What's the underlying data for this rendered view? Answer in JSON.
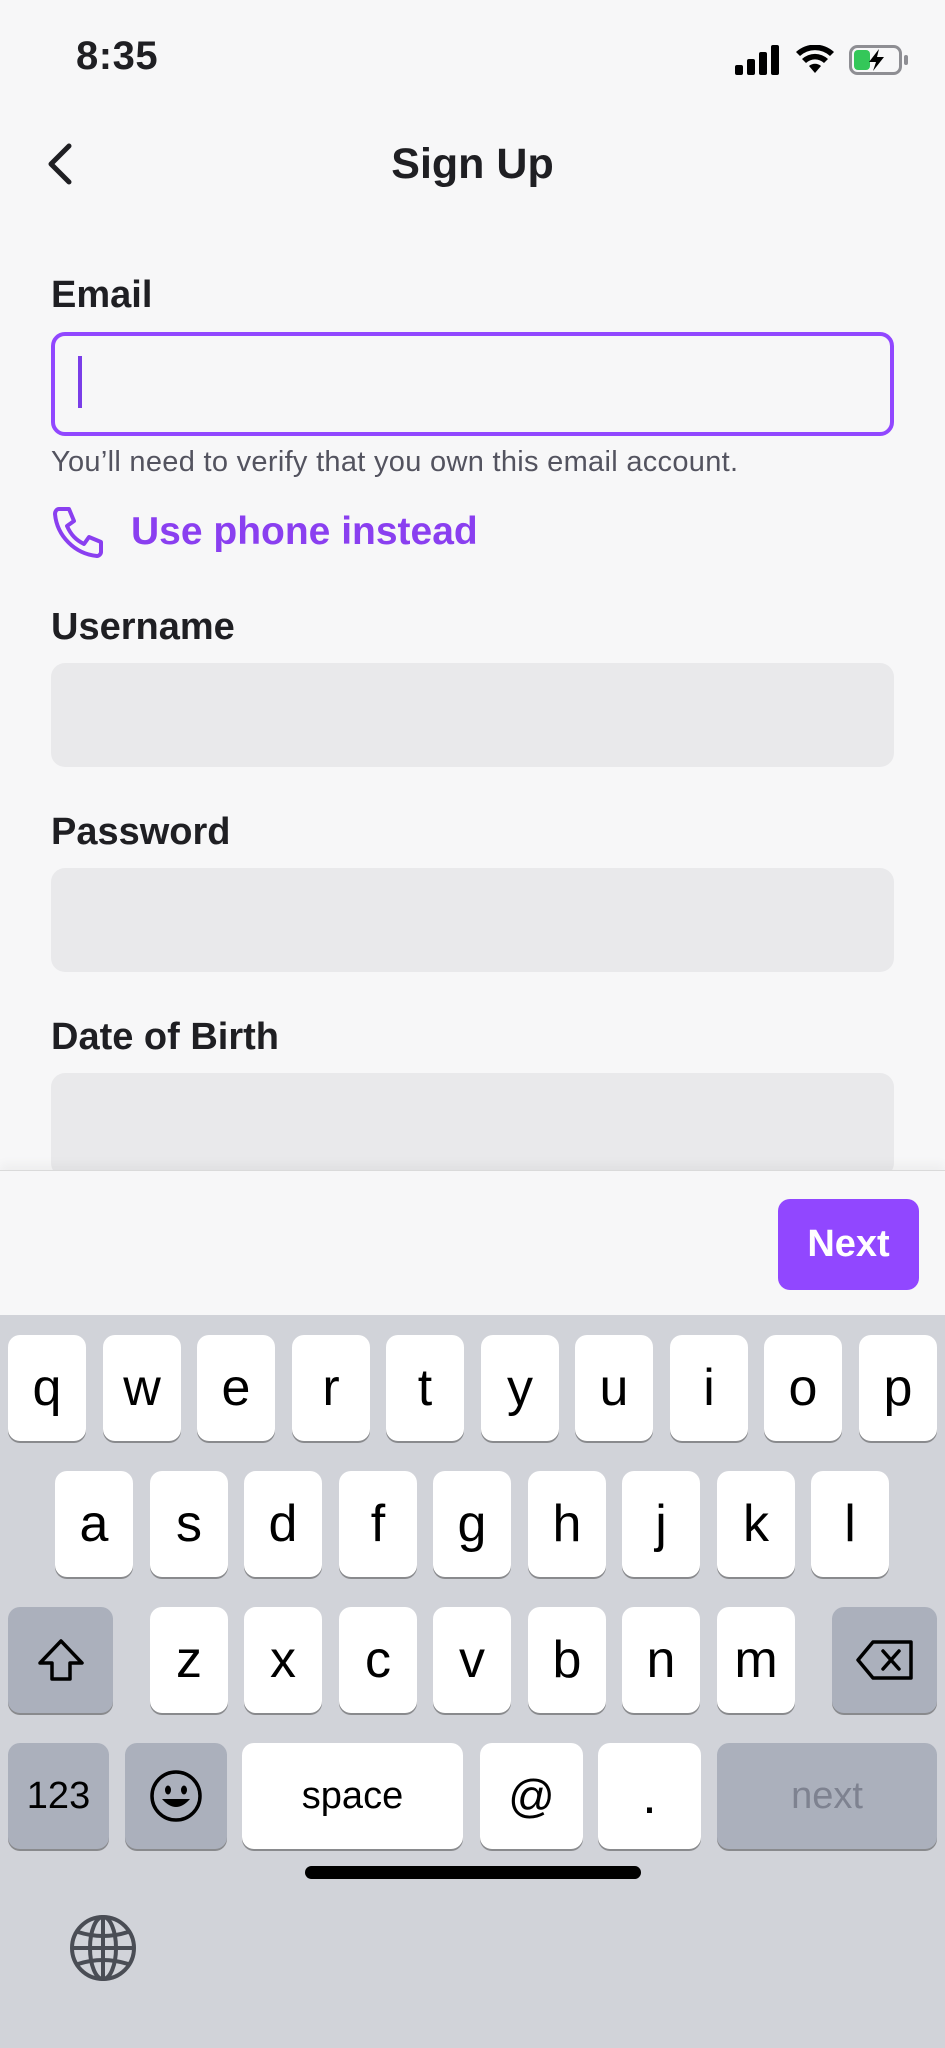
{
  "status_bar": {
    "time": "8:35"
  },
  "header": {
    "title": "Sign Up",
    "back_icon": "chevron-left-icon"
  },
  "form": {
    "email": {
      "label": "Email",
      "value": "",
      "placeholder": ""
    },
    "email_helper": "You’ll need to verify that you own this email account.",
    "use_phone": "Use phone instead",
    "username": {
      "label": "Username",
      "value": ""
    },
    "password": {
      "label": "Password",
      "value": ""
    },
    "dob": {
      "label": "Date of Birth",
      "value": ""
    }
  },
  "accessory": {
    "next_label": "Next"
  },
  "keyboard": {
    "row1": [
      "q",
      "w",
      "e",
      "r",
      "t",
      "y",
      "u",
      "i",
      "o",
      "p"
    ],
    "row2": [
      "a",
      "s",
      "d",
      "f",
      "g",
      "h",
      "j",
      "k",
      "l"
    ],
    "row3": [
      "z",
      "x",
      "c",
      "v",
      "b",
      "n",
      "m"
    ],
    "numbers_label": "123",
    "space_label": "space",
    "at_label": "@",
    "dot_label": ".",
    "return_label": "next"
  },
  "colors": {
    "accent": "#9147ff",
    "accent_text": "#8a3ff0",
    "field_bg": "#e9e9eb",
    "keyboard_bg": "#d1d3d9"
  }
}
